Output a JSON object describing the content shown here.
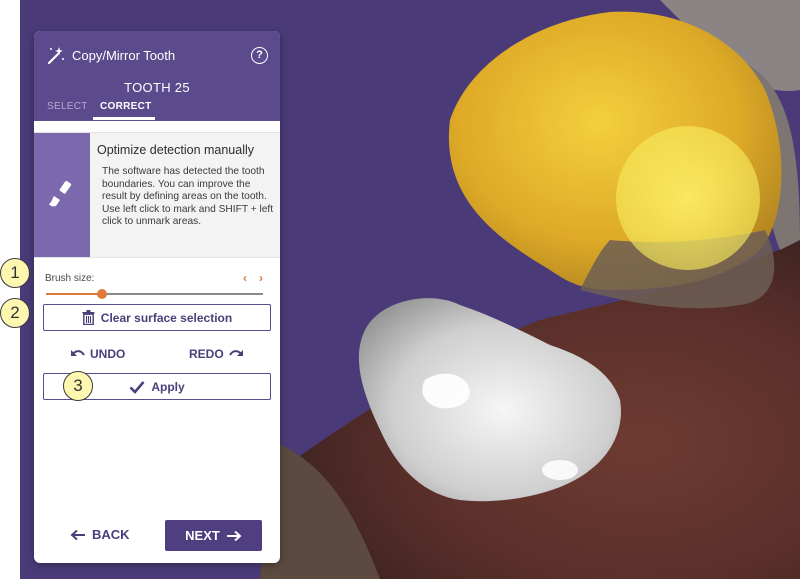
{
  "panel": {
    "title": "Copy/Mirror Tooth",
    "tooth_label": "TOOTH 25",
    "tabs": [
      {
        "label": "SELECT",
        "active": false
      },
      {
        "label": "CORRECT",
        "active": true
      }
    ]
  },
  "info": {
    "title": "Optimize detection manually",
    "body": "The software has detected the tooth boundaries. You can improve the result by defining areas on the tooth. Use left click to mark and SHIFT + left click to unmark areas."
  },
  "brush": {
    "label": "Brush size:",
    "prev_glyph": "‹",
    "next_glyph": "›",
    "level": 0.26
  },
  "buttons": {
    "clear": "Clear surface selection",
    "undo": "UNDO",
    "redo": "REDO",
    "apply": "Apply",
    "back": "BACK",
    "next": "NEXT"
  },
  "callouts": [
    "1",
    "2",
    "3"
  ],
  "icons": {
    "wand": "magic-wand-icon",
    "help": "help-icon",
    "brush": "paintbrush-icon",
    "trash": "trash-icon",
    "check": "checkmark-icon",
    "undo": "undo-arrow-icon",
    "redo": "redo-arrow-icon",
    "back": "arrow-left-icon",
    "next": "arrow-right-icon"
  },
  "colors": {
    "viewport_bg": "#4a3b78",
    "panel_header": "#5b4a8c",
    "accent_orange": "#e07a3a",
    "primary_button": "#4f3f80",
    "tooth_highlight": "#e3b42a",
    "callout_fill": "#fdf7b0"
  }
}
